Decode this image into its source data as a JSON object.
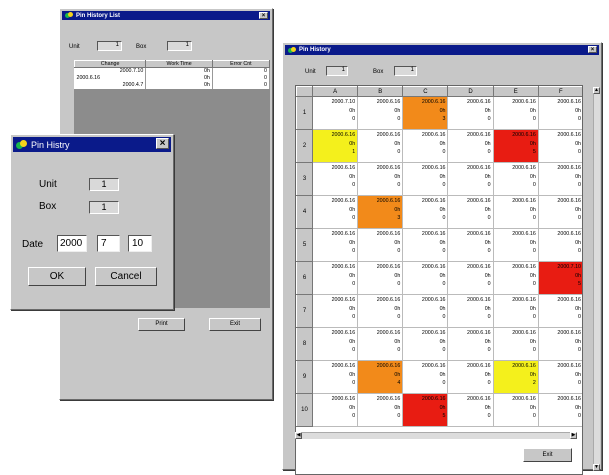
{
  "list_window": {
    "title": "Pin History List",
    "unit_label": "Unit",
    "unit_value": "1",
    "box_label": "Box",
    "box_value": "1",
    "columns": [
      "Change",
      "Work Time",
      "Error Cnt"
    ],
    "rows": [
      [
        "2000.7.10",
        "0h",
        "0"
      ],
      [
        "2000.6.16",
        "0h",
        "0"
      ],
      [
        "2000.4.7",
        "0h",
        "0"
      ]
    ],
    "print_label": "Print",
    "exit_label": "Exit"
  },
  "dialog": {
    "title": "Pin Histry",
    "unit_label": "Unit",
    "unit_value": "1",
    "box_label": "Box",
    "box_value": "1",
    "date_label": "Date",
    "year": "2000",
    "month": "7",
    "day": "10",
    "ok_label": "OK",
    "cancel_label": "Cancel"
  },
  "grid_window": {
    "title": "Pin History",
    "unit_label": "Unit",
    "unit_value": "1",
    "box_label": "Box",
    "box_value": "1",
    "exit_label": "Exit",
    "columns": [
      "A",
      "B",
      "C",
      "D",
      "E",
      "F"
    ],
    "rows": [
      {
        "n": "1",
        "cells": [
          [
            "2000.7.10",
            "0h",
            "0",
            ""
          ],
          [
            "2000.6.16",
            "0h",
            "0",
            ""
          ],
          [
            "2000.6.16",
            "0h",
            "3",
            "orange"
          ],
          [
            "2000.6.16",
            "0h",
            "0",
            ""
          ],
          [
            "2000.6.16",
            "0h",
            "0",
            ""
          ],
          [
            "2000.6.16",
            "0h",
            "0",
            ""
          ]
        ]
      },
      {
        "n": "2",
        "cells": [
          [
            "2000.6.16",
            "0h",
            "1",
            "yellow"
          ],
          [
            "2000.6.16",
            "0h",
            "0",
            ""
          ],
          [
            "2000.6.16",
            "0h",
            "0",
            ""
          ],
          [
            "2000.6.16",
            "0h",
            "0",
            ""
          ],
          [
            "2000.6.16",
            "0h",
            "5",
            "red"
          ],
          [
            "2000.6.16",
            "0h",
            "0",
            ""
          ]
        ]
      },
      {
        "n": "3",
        "cells": [
          [
            "2000.6.16",
            "0h",
            "0",
            ""
          ],
          [
            "2000.6.16",
            "0h",
            "0",
            ""
          ],
          [
            "2000.6.16",
            "0h",
            "0",
            ""
          ],
          [
            "2000.6.16",
            "0h",
            "0",
            ""
          ],
          [
            "2000.6.16",
            "0h",
            "0",
            ""
          ],
          [
            "2000.6.16",
            "0h",
            "0",
            ""
          ]
        ]
      },
      {
        "n": "4",
        "cells": [
          [
            "2000.6.16",
            "0h",
            "0",
            ""
          ],
          [
            "2000.6.16",
            "0h",
            "3",
            "orange"
          ],
          [
            "2000.6.16",
            "0h",
            "0",
            ""
          ],
          [
            "2000.6.16",
            "0h",
            "0",
            ""
          ],
          [
            "2000.6.16",
            "0h",
            "0",
            ""
          ],
          [
            "2000.6.16",
            "0h",
            "0",
            ""
          ]
        ]
      },
      {
        "n": "5",
        "cells": [
          [
            "2000.6.16",
            "0h",
            "0",
            ""
          ],
          [
            "2000.6.16",
            "0h",
            "0",
            ""
          ],
          [
            "2000.6.16",
            "0h",
            "0",
            ""
          ],
          [
            "2000.6.16",
            "0h",
            "0",
            ""
          ],
          [
            "2000.6.16",
            "0h",
            "0",
            ""
          ],
          [
            "2000.6.16",
            "0h",
            "0",
            ""
          ]
        ]
      },
      {
        "n": "6",
        "cells": [
          [
            "2000.6.16",
            "0h",
            "0",
            ""
          ],
          [
            "2000.6.16",
            "0h",
            "0",
            ""
          ],
          [
            "2000.6.16",
            "0h",
            "0",
            ""
          ],
          [
            "2000.6.16",
            "0h",
            "0",
            ""
          ],
          [
            "2000.6.16",
            "0h",
            "0",
            ""
          ],
          [
            "2000.7.10",
            "0h",
            "5",
            "red"
          ]
        ]
      },
      {
        "n": "7",
        "cells": [
          [
            "2000.6.16",
            "0h",
            "0",
            ""
          ],
          [
            "2000.6.16",
            "0h",
            "0",
            ""
          ],
          [
            "2000.6.16",
            "0h",
            "0",
            ""
          ],
          [
            "2000.6.16",
            "0h",
            "0",
            ""
          ],
          [
            "2000.6.16",
            "0h",
            "0",
            ""
          ],
          [
            "2000.6.16",
            "0h",
            "0",
            ""
          ]
        ]
      },
      {
        "n": "8",
        "cells": [
          [
            "2000.6.16",
            "0h",
            "0",
            ""
          ],
          [
            "2000.6.16",
            "0h",
            "0",
            ""
          ],
          [
            "2000.6.16",
            "0h",
            "0",
            ""
          ],
          [
            "2000.6.16",
            "0h",
            "0",
            ""
          ],
          [
            "2000.6.16",
            "0h",
            "0",
            ""
          ],
          [
            "2000.6.16",
            "0h",
            "0",
            ""
          ]
        ]
      },
      {
        "n": "9",
        "cells": [
          [
            "2000.6.16",
            "0h",
            "0",
            ""
          ],
          [
            "2000.6.16",
            "0h",
            "4",
            "orange"
          ],
          [
            "2000.6.16",
            "0h",
            "0",
            ""
          ],
          [
            "2000.6.16",
            "0h",
            "0",
            ""
          ],
          [
            "2000.6.16",
            "0h",
            "2",
            "yellow"
          ],
          [
            "2000.6.16",
            "0h",
            "0",
            ""
          ]
        ]
      },
      {
        "n": "10",
        "cells": [
          [
            "2000.6.16",
            "0h",
            "0",
            ""
          ],
          [
            "2000.6.16",
            "0h",
            "0",
            ""
          ],
          [
            "2000.6.16",
            "0h",
            "5",
            "red"
          ],
          [
            "2000.6.16",
            "0h",
            "0",
            ""
          ],
          [
            "2000.6.16",
            "0h",
            "0",
            ""
          ],
          [
            "2000.6.16",
            "0h",
            "0",
            ""
          ]
        ]
      }
    ]
  },
  "colors": {
    "orange": "#f28a1a",
    "yellow": "#f4f01c",
    "red": "#e81c12",
    "titlebar": "#0a1a8a"
  },
  "icons": {
    "app": "app-logo-icon",
    "close": "close-icon"
  }
}
